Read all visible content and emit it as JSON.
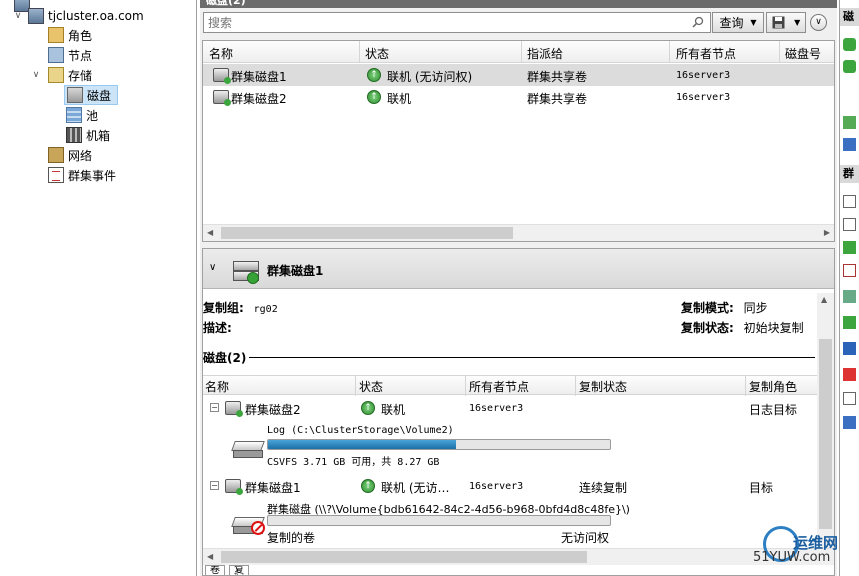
{
  "tree": {
    "root_label": "tjcluster.oa.com",
    "items": [
      {
        "label": "角色"
      },
      {
        "label": "节点"
      },
      {
        "label": "存储"
      },
      {
        "label": "磁盘"
      },
      {
        "label": "池"
      },
      {
        "label": "机箱"
      },
      {
        "label": "网络"
      },
      {
        "label": "群集事件"
      }
    ]
  },
  "main": {
    "title": "磁盘(2)",
    "search_placeholder": "搜索",
    "query_label": "查询",
    "columns": [
      "名称",
      "状态",
      "指派给",
      "所有者节点",
      "磁盘号"
    ],
    "rows": [
      {
        "name": "群集磁盘1",
        "status": "联机 (无访问权)",
        "assigned": "群集共享卷",
        "owner": "16server3"
      },
      {
        "name": "群集磁盘2",
        "status": "联机",
        "assigned": "群集共享卷",
        "owner": "16server3"
      }
    ]
  },
  "detail": {
    "title": "群集磁盘1",
    "replication_group_label": "复制组:",
    "replication_group_value": "rg02",
    "description_label": "描述:",
    "replication_mode_label": "复制模式:",
    "replication_mode_value": "同步",
    "replication_status_label": "复制状态:",
    "replication_status_value": "初始块复制",
    "group_heading": "磁盘(2)",
    "columns": [
      "名称",
      "状态",
      "所有者节点",
      "复制状态",
      "复制角色"
    ],
    "disks": [
      {
        "name": "群集磁盘2",
        "status": "联机",
        "owner": "16server3",
        "replication_status": "",
        "role": "日志目标",
        "volume_path": "Log (C:\\ClusterStorage\\Volume2)",
        "fs_info": "CSVFS 3.71 GB 可用，共 8.27 GB",
        "usage_fraction": 0.55
      },
      {
        "name": "群集磁盘1",
        "status": "联机 (无访…",
        "owner": "16server3",
        "replication_status": "连续复制",
        "role": "目标",
        "volume_path": "群集磁盘 (\\\\?\\Volume{bdb61642-84c2-4d56-b968-0bfd4d8c48fe}\\)",
        "volume_label": "复制的卷",
        "access": "无访问权",
        "usage_fraction": 0.0
      }
    ],
    "tabs": [
      "卷",
      "复制"
    ]
  },
  "actions": {
    "header1": "磁",
    "header2": "群"
  },
  "watermark": {
    "line1": "运维网",
    "line2": "51YUW.com"
  },
  "colors": {
    "accent": "#1b70a8",
    "online_green": "#2e8b2e",
    "selected_row": "#dcdcdc"
  }
}
